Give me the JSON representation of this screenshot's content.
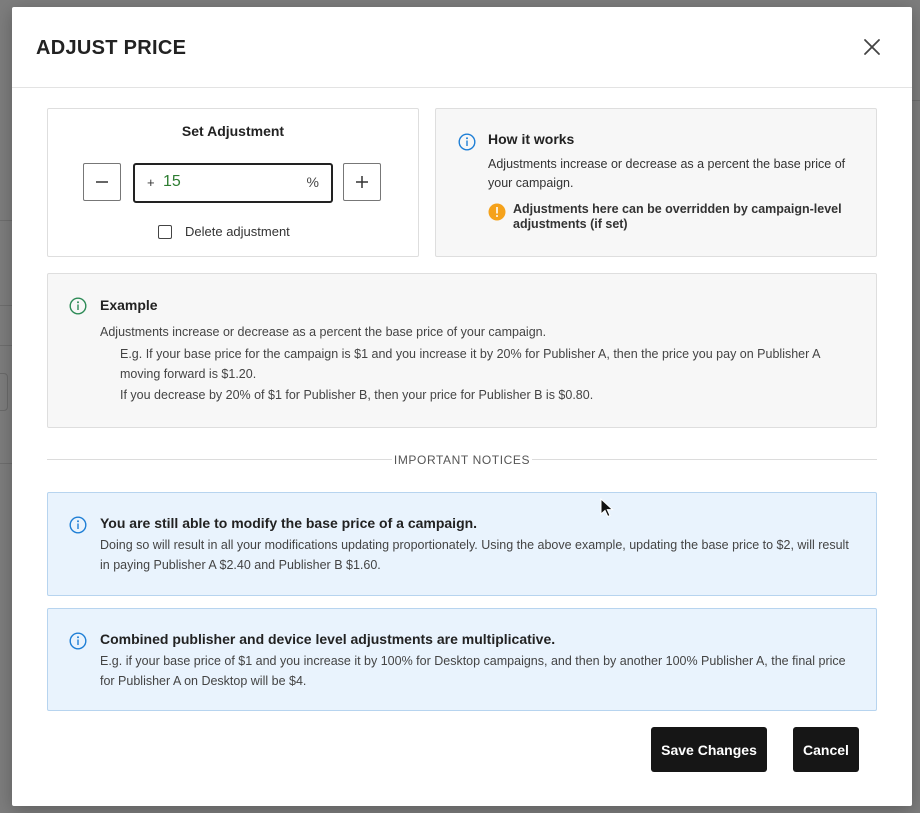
{
  "modal": {
    "title": "ADJUST PRICE"
  },
  "set_adjustment": {
    "title": "Set Adjustment",
    "sign": "+",
    "value": "15",
    "unit": "%",
    "delete_label": "Delete adjustment",
    "delete_checked": false
  },
  "how_it_works": {
    "title": "How it works",
    "text": "Adjustments increase or decrease as a percent the base price of your campaign.",
    "warning": "Adjustments here can be overridden by campaign-level adjustments (if set)"
  },
  "example": {
    "title": "Example",
    "intro": "Adjustments increase or decrease as a percent the base price of your campaign.",
    "line1": "E.g. If your base price for the campaign is $1 and you increase it by 20% for Publisher A, then the price you pay on Publisher A moving forward is $1.20.",
    "line2": "If you decrease by 20% of $1 for Publisher B, then your price for Publisher B is $0.80."
  },
  "notices": {
    "heading": "IMPORTANT NOTICES",
    "items": [
      {
        "title": "You are still able to modify the base price of a campaign.",
        "text": "Doing so will result in all your modifications updating proportionately. Using the above example, updating the base price to $2, will result in paying Publisher A $2.40 and Publisher B $1.60."
      },
      {
        "title": "Combined publisher and device level adjustments are multiplicative.",
        "text": "E.g. if your base price of $1 and you increase it by 100% for Desktop campaigns, and then by another 100% Publisher A, the final price for Publisher A on Desktop will be $4."
      }
    ]
  },
  "actions": {
    "save_label": "Save Changes",
    "cancel_label": "Cancel"
  },
  "colors": {
    "accent_dark": "#161616",
    "info_blue": "#1f7fd6",
    "info_green": "#2e8b57",
    "warning_orange": "#f5a21b",
    "value_green": "#2e7d32",
    "notice_bg": "#e9f3fd"
  },
  "icons": {
    "close": "close-icon",
    "minus": "minus-icon",
    "plus": "plus-icon",
    "info": "info-icon",
    "warning": "warning-icon",
    "cursor": "mouse-pointer-icon"
  }
}
